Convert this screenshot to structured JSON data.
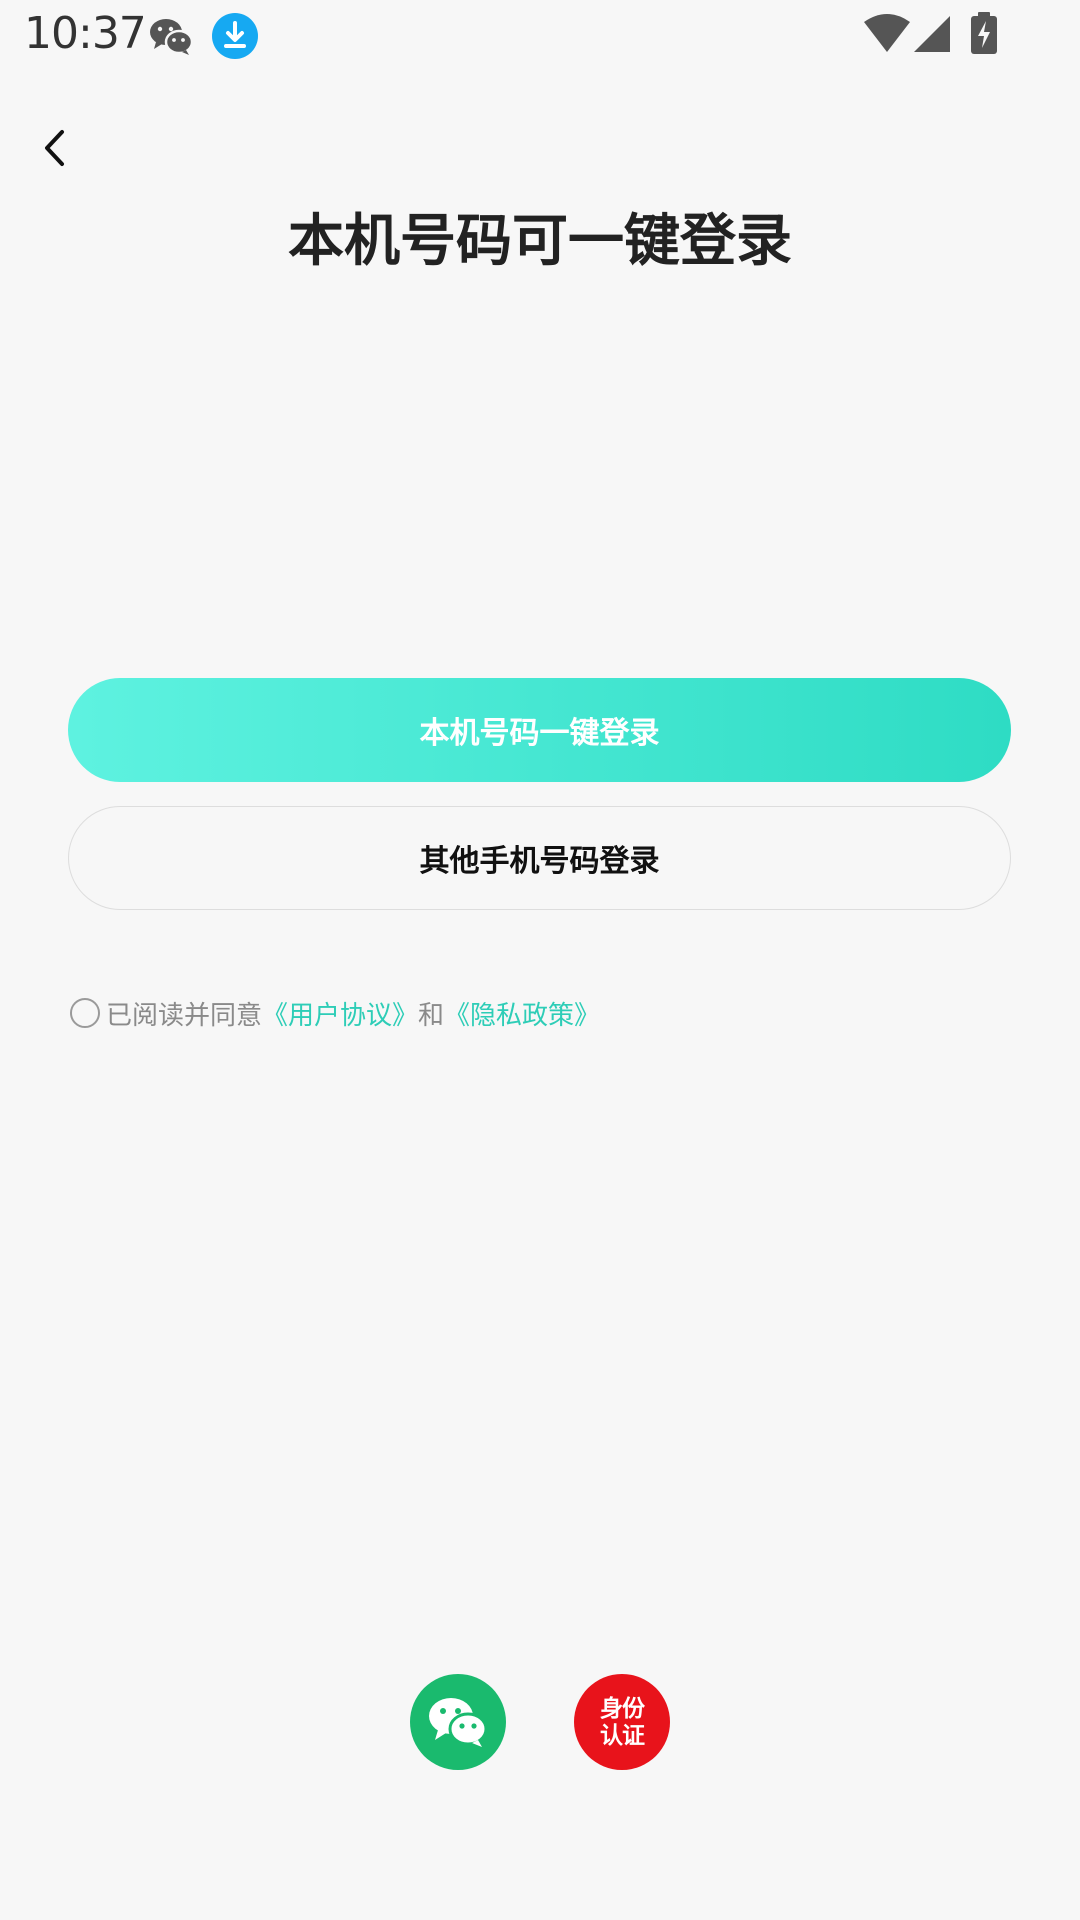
{
  "status_bar": {
    "time": "10:37",
    "icons": [
      "wechat-icon",
      "download-icon",
      "wifi-icon",
      "signal-icon",
      "battery-charging-icon"
    ],
    "download_color": "#16a9f2"
  },
  "header": {
    "back_icon": "chevron-left-icon",
    "title": "本机号码可一键登录"
  },
  "buttons": {
    "one_click_login": "本机号码一键登录",
    "other_number_login": "其他手机号码登录"
  },
  "agreement": {
    "checked": false,
    "prefix": "已阅读并同意",
    "user_agreement": "《用户协议》",
    "conjunction": "和",
    "privacy_policy": "《隐私政策》",
    "link_color": "#2ecdb7"
  },
  "third_party_login": {
    "wechat_icon": "wechat-icon",
    "wechat_color": "#1aba6e",
    "identity_line1": "身份",
    "identity_line2": "认证",
    "identity_color": "#e8131b"
  }
}
